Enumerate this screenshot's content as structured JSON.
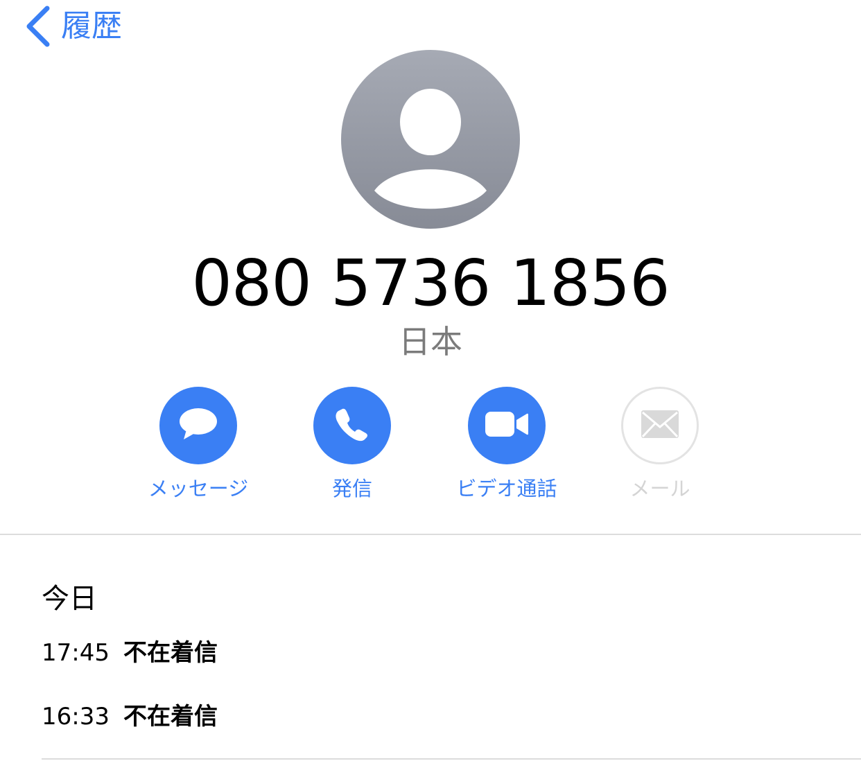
{
  "nav": {
    "back_label": "履歴"
  },
  "contact": {
    "phone_number": "080 5736 1856",
    "country": "日本"
  },
  "actions": [
    {
      "label": "メッセージ",
      "icon": "message-bubble-icon",
      "enabled": true
    },
    {
      "label": "発信",
      "icon": "phone-icon",
      "enabled": true
    },
    {
      "label": "ビデオ通話",
      "icon": "video-camera-icon",
      "enabled": true
    },
    {
      "label": "メール",
      "icon": "mail-envelope-icon",
      "enabled": false
    }
  ],
  "history": {
    "section_title": "今日",
    "calls": [
      {
        "time": "17:45",
        "type": "不在着信"
      },
      {
        "time": "16:33",
        "type": "不在着信"
      }
    ]
  },
  "colors": {
    "accent": "#3a7ff4",
    "disabled": "#d4d4d4",
    "secondary_text": "#7b7b7b",
    "avatar_gray": "#9a9ea8"
  }
}
